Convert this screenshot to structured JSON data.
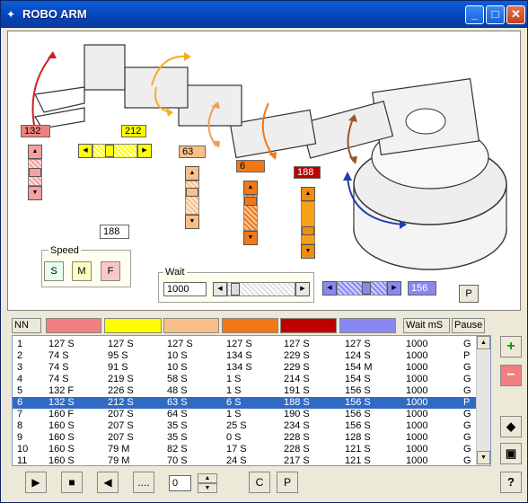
{
  "window": {
    "title": "ROBO ARM"
  },
  "colors": {
    "c1": "#f08080",
    "c2": "#ffff00",
    "c3": "#f8c088",
    "c4": "#f07818",
    "c5": "#c00000",
    "c6": "#8888f0"
  },
  "controls": {
    "j1_value": "132",
    "j2_value": "212",
    "j3_value": "63",
    "j4_value": "6",
    "j5_value": "188",
    "j6_value": "156",
    "extra_value": "188",
    "speed_label": "Speed",
    "speed_s": "S",
    "speed_m": "M",
    "speed_f": "F",
    "wait_label": "Wait",
    "wait_value": "1000",
    "p_label": "P"
  },
  "sliders": {
    "j1": 0.52,
    "j2": 0.33,
    "j3": 0.25,
    "j4": 0.03,
    "j5": 0.74,
    "j6": 0.61,
    "wait": 0.05
  },
  "table": {
    "headers": {
      "nn": "NN",
      "wait": "Wait mS",
      "pause": "Pause"
    },
    "rows": [
      [
        "1",
        "127 S",
        "127 S",
        "127 S",
        "127 S",
        "127 S",
        "127 S",
        "1000",
        "G"
      ],
      [
        "2",
        "74 S",
        "95 S",
        "10 S",
        "134 S",
        "229 S",
        "124 S",
        "1000",
        "P"
      ],
      [
        "3",
        "74 S",
        "91 S",
        "10 S",
        "134 S",
        "229 S",
        "154 M",
        "1000",
        "G"
      ],
      [
        "4",
        "74 S",
        "219 S",
        "58 S",
        "1 S",
        "214 S",
        "154 S",
        "1000",
        "G"
      ],
      [
        "5",
        "132 F",
        "226 S",
        "48 S",
        "1 S",
        "191 S",
        "156 S",
        "1000",
        "G"
      ],
      [
        "6",
        "132 S",
        "212 S",
        "63 S",
        "6 S",
        "188 S",
        "156 S",
        "1000",
        "P"
      ],
      [
        "7",
        "160 F",
        "207 S",
        "64 S",
        "1 S",
        "190 S",
        "156 S",
        "1000",
        "G"
      ],
      [
        "8",
        "160 S",
        "207 S",
        "35 S",
        "25 S",
        "234 S",
        "156 S",
        "1000",
        "G"
      ],
      [
        "9",
        "160 S",
        "207 S",
        "35 S",
        "0 S",
        "228 S",
        "128 S",
        "1000",
        "G"
      ],
      [
        "10",
        "160 S",
        "79 M",
        "82 S",
        "17 S",
        "228 S",
        "121 S",
        "1000",
        "G"
      ],
      [
        "11",
        "160 S",
        "79 M",
        "70 S",
        "24 S",
        "217 S",
        "121 S",
        "1000",
        "G"
      ]
    ],
    "selected_row": 5
  },
  "bottom": {
    "counter": "0",
    "c_label": "C",
    "p_label": "P"
  }
}
